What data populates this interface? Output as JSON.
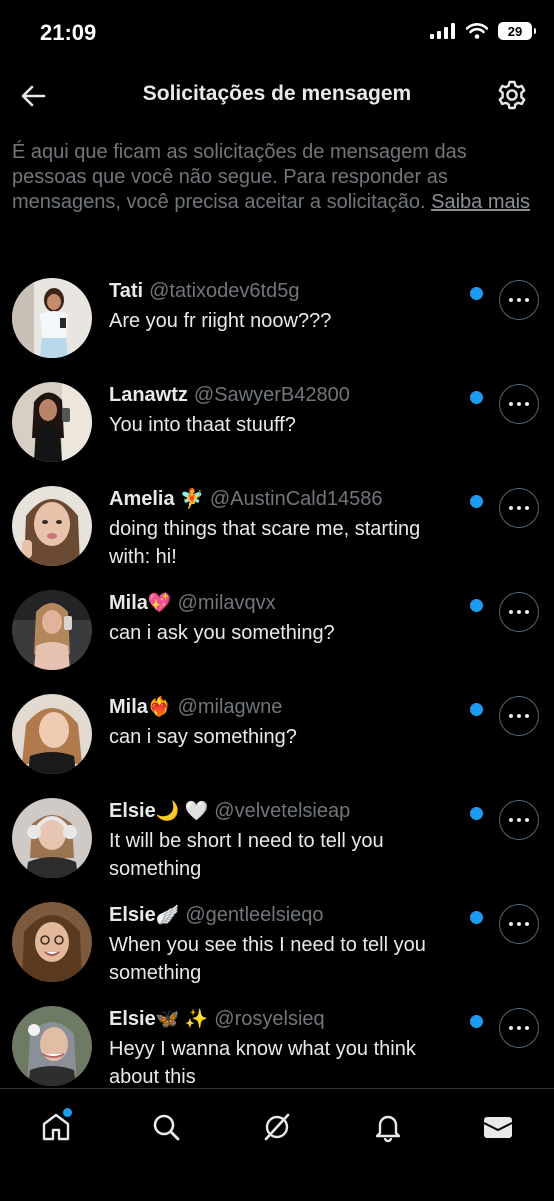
{
  "status": {
    "time": "21:09",
    "battery": "29"
  },
  "header": {
    "title": "Solicitações de mensagem"
  },
  "info": {
    "text": "É aqui que ficam as solicitações de mensagem das pessoas que você não segue. Para responder as mensagens, você precisa aceitar a solicitação.",
    "link": "Saiba mais"
  },
  "requests": [
    {
      "name": "Tati",
      "emoji": "",
      "handle": "@tatixodev6td5g",
      "message": "Are you fr riight noow???"
    },
    {
      "name": "Lanawtz",
      "emoji": "",
      "handle": "@SawyerB42800",
      "message": "You into thaat stuuff?"
    },
    {
      "name": "Amelia",
      "emoji": "🧚",
      "handle": "@AustinCald14586",
      "message": "doing things that scare me, starting with: hi!"
    },
    {
      "name": "Mila",
      "emoji": "💖",
      "handle": "@milavqvx",
      "message": "can i ask you something?"
    },
    {
      "name": "Mila",
      "emoji": "❤️‍🔥",
      "handle": "@milagwne",
      "message": "can i say something?"
    },
    {
      "name": "Elsie",
      "emoji": "🌙 🤍",
      "handle": "@velvetelsieap",
      "message": "It will be short I need to tell you something"
    },
    {
      "name": "Elsie",
      "emoji": "🪽",
      "handle": "@gentleelsieqo",
      "message": "When you see this I need to tell you something"
    },
    {
      "name": "Elsie",
      "emoji": "🦋 ✨",
      "handle": "@rosyelsieq",
      "message": "Heyy I wanna know what you think about this"
    }
  ],
  "colors": {
    "background": "#000000",
    "accent": "#1d9bf0",
    "secondary_text": "#71767b"
  },
  "nav": [
    "home-icon",
    "search-icon",
    "grok-icon",
    "bell-icon",
    "mail-icon"
  ]
}
